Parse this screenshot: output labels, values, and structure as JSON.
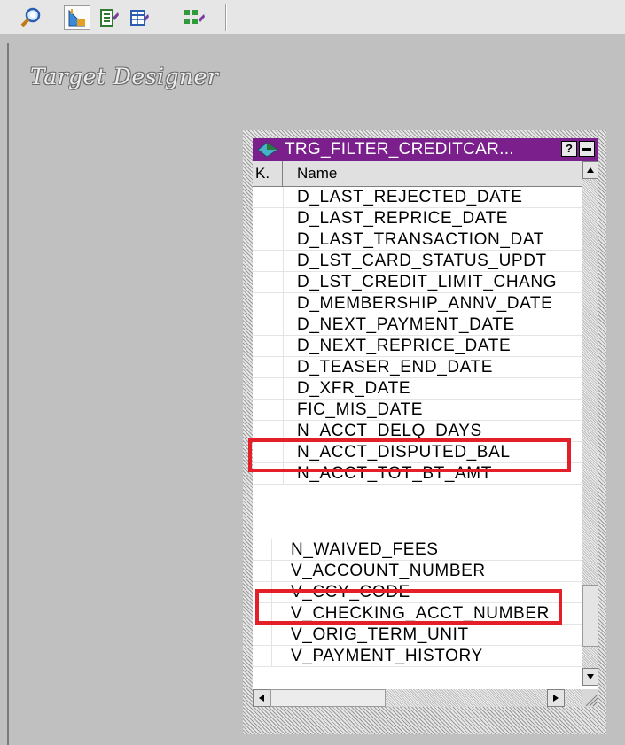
{
  "toolbar": {
    "buttons": [
      {
        "icon": "find-icon"
      },
      {
        "icon": "target-designer-icon",
        "active": true
      },
      {
        "icon": "edit-icon"
      },
      {
        "icon": "table-icon"
      },
      {
        "icon": "link-icon"
      }
    ]
  },
  "workspace": {
    "title": "Target Designer"
  },
  "table_window": {
    "title": "TRG_FILTER_CREDITCAR...",
    "help_label": "?",
    "columns": {
      "key": "K.",
      "name": "Name"
    },
    "rows_upper": [
      "D_LAST_REJECTED_DATE",
      "D_LAST_REPRICE_DATE",
      "D_LAST_TRANSACTION_DAT",
      "D_LST_CARD_STATUS_UPDT",
      "D_LST_CREDIT_LIMIT_CHANG",
      "D_MEMBERSHIP_ANNV_DATE",
      "D_NEXT_PAYMENT_DATE",
      "D_NEXT_REPRICE_DATE",
      "D_TEASER_END_DATE",
      "D_XFR_DATE",
      "FIC_MIS_DATE",
      "N_ACCT_DELQ_DAYS",
      "N_ACCT_DISPUTED_BAL",
      "N_ACCT_TOT_BT_AMT"
    ],
    "rows_lower": [
      "N_WAIVED_FEES",
      "V_ACCOUNT_NUMBER",
      "V_CCY_CODE",
      "V_CHECKING_ACCT_NUMBER",
      "V_ORIG_TERM_UNIT",
      "V_PAYMENT_HISTORY"
    ],
    "highlighted": [
      "FIC_MIS_DATE",
      "V_CCY_CODE"
    ],
    "highlight_color": "#e3202a",
    "titlebar_color": "#7a1f8c"
  }
}
